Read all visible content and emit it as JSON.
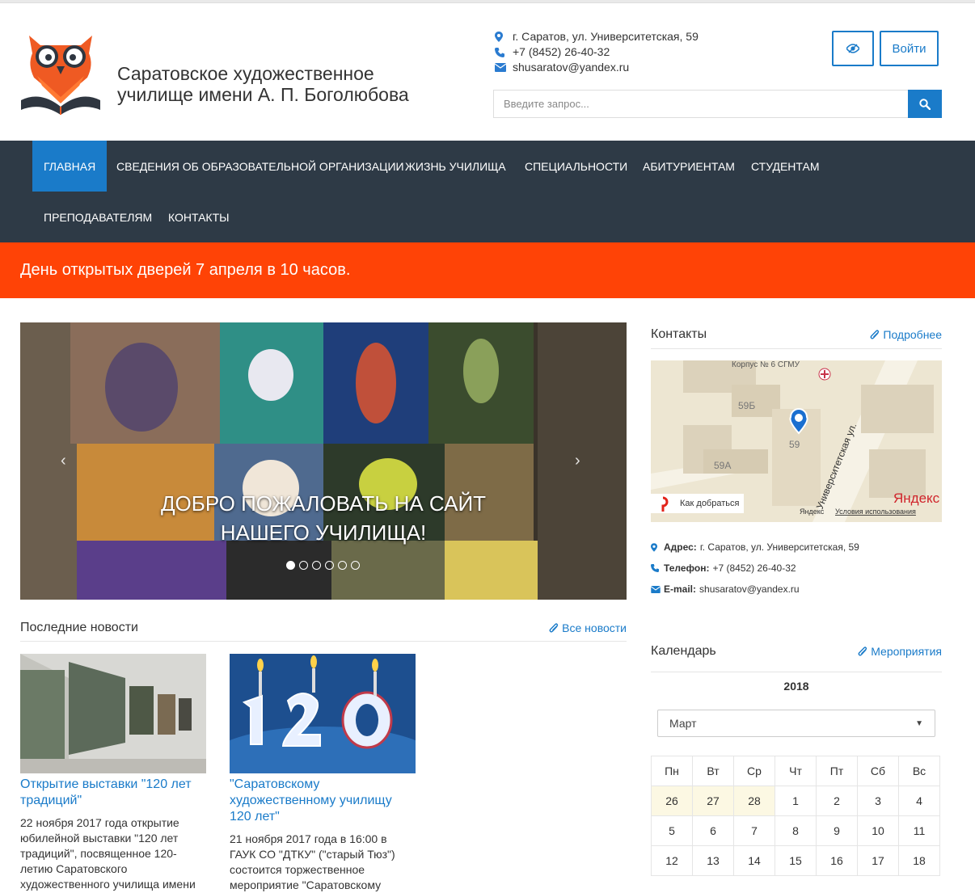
{
  "header": {
    "site_title_line1": "Саратовское художественное",
    "site_title_line2": "училище имени А. П. Боголюбова",
    "address": "г. Саратов, ул. Университетская, 59",
    "phone": "+7 (8452) 26-40-32",
    "email": "shusaratov@yandex.ru",
    "login_label": "Войти",
    "search_placeholder": "Введите запрос..."
  },
  "nav": {
    "items": [
      {
        "label": "Главная",
        "active": true
      },
      {
        "label": "Сведения об образовательной организации"
      },
      {
        "label": "Жизнь училища"
      },
      {
        "label": "Специальности"
      },
      {
        "label": "Абитуриентам"
      },
      {
        "label": "Студентам"
      },
      {
        "label": "Преподавателям"
      },
      {
        "label": "Контакты"
      }
    ]
  },
  "announcement": "День открытых дверей 7 апреля в 10 часов.",
  "slider": {
    "caption_line1": "ДОБРО ПОЖАЛОВАТЬ НА САЙТ",
    "caption_line2": "НАШЕГО УЧИЛИЩА!",
    "prev": "‹",
    "next": "›",
    "slide_count": 6,
    "active_slide": 1
  },
  "news": {
    "title": "Последние новости",
    "all_link": "Все новости",
    "items": [
      {
        "title": "Открытие выставки \"120 лет традиций\"",
        "text": "22 ноября 2017 года открытие юбилейной выставки \"120 лет традиций\", посвященное 120-летию Саратовского художественного училища имени"
      },
      {
        "title": "\"Саратовскому художественному училищу 120 лет\"",
        "text": "21 ноября 2017 года в 16:00 в ГАУК СО \"ДТКУ\" (\"старый Тюз\") состоится торжественное мероприятие \"Саратовскому"
      }
    ]
  },
  "contacts_widget": {
    "title": "Контакты",
    "more_link": "Подробнее",
    "address_label": "Адрес:",
    "address": "г. Саратов, ул. Университетская, 59",
    "phone_label": "Телефон:",
    "phone": "+7 (8452) 26-40-32",
    "email_label": "E-mail:",
    "email": "shusaratov@yandex.ru",
    "map": {
      "label_korpus": "Корпус № 6 СГМУ",
      "label_59b": "59Б",
      "label_59": "59",
      "label_59a": "59А",
      "street": "Университетская ул.",
      "route": "Как добраться",
      "brand": "Яндекс",
      "brand_small": "Яндекс",
      "terms": "Условия использования"
    }
  },
  "calendar": {
    "title": "Календарь",
    "events_link": "Мероприятия",
    "year": "2018",
    "month": "Март",
    "weekdays": [
      "Пн",
      "Вт",
      "Ср",
      "Чт",
      "Пт",
      "Сб",
      "Вс"
    ],
    "weeks": [
      [
        "26",
        "27",
        "28",
        "1",
        "2",
        "3",
        "4"
      ],
      [
        "5",
        "6",
        "7",
        "8",
        "9",
        "10",
        "11"
      ],
      [
        "12",
        "13",
        "14",
        "15",
        "16",
        "17",
        "18"
      ]
    ],
    "prev_month_days": 3
  },
  "colors": {
    "accent": "#1a7bc9",
    "nav_bg": "#2e3a46",
    "announcement_bg": "#ff4306",
    "prev_month_bg": "#fcf8e3"
  }
}
